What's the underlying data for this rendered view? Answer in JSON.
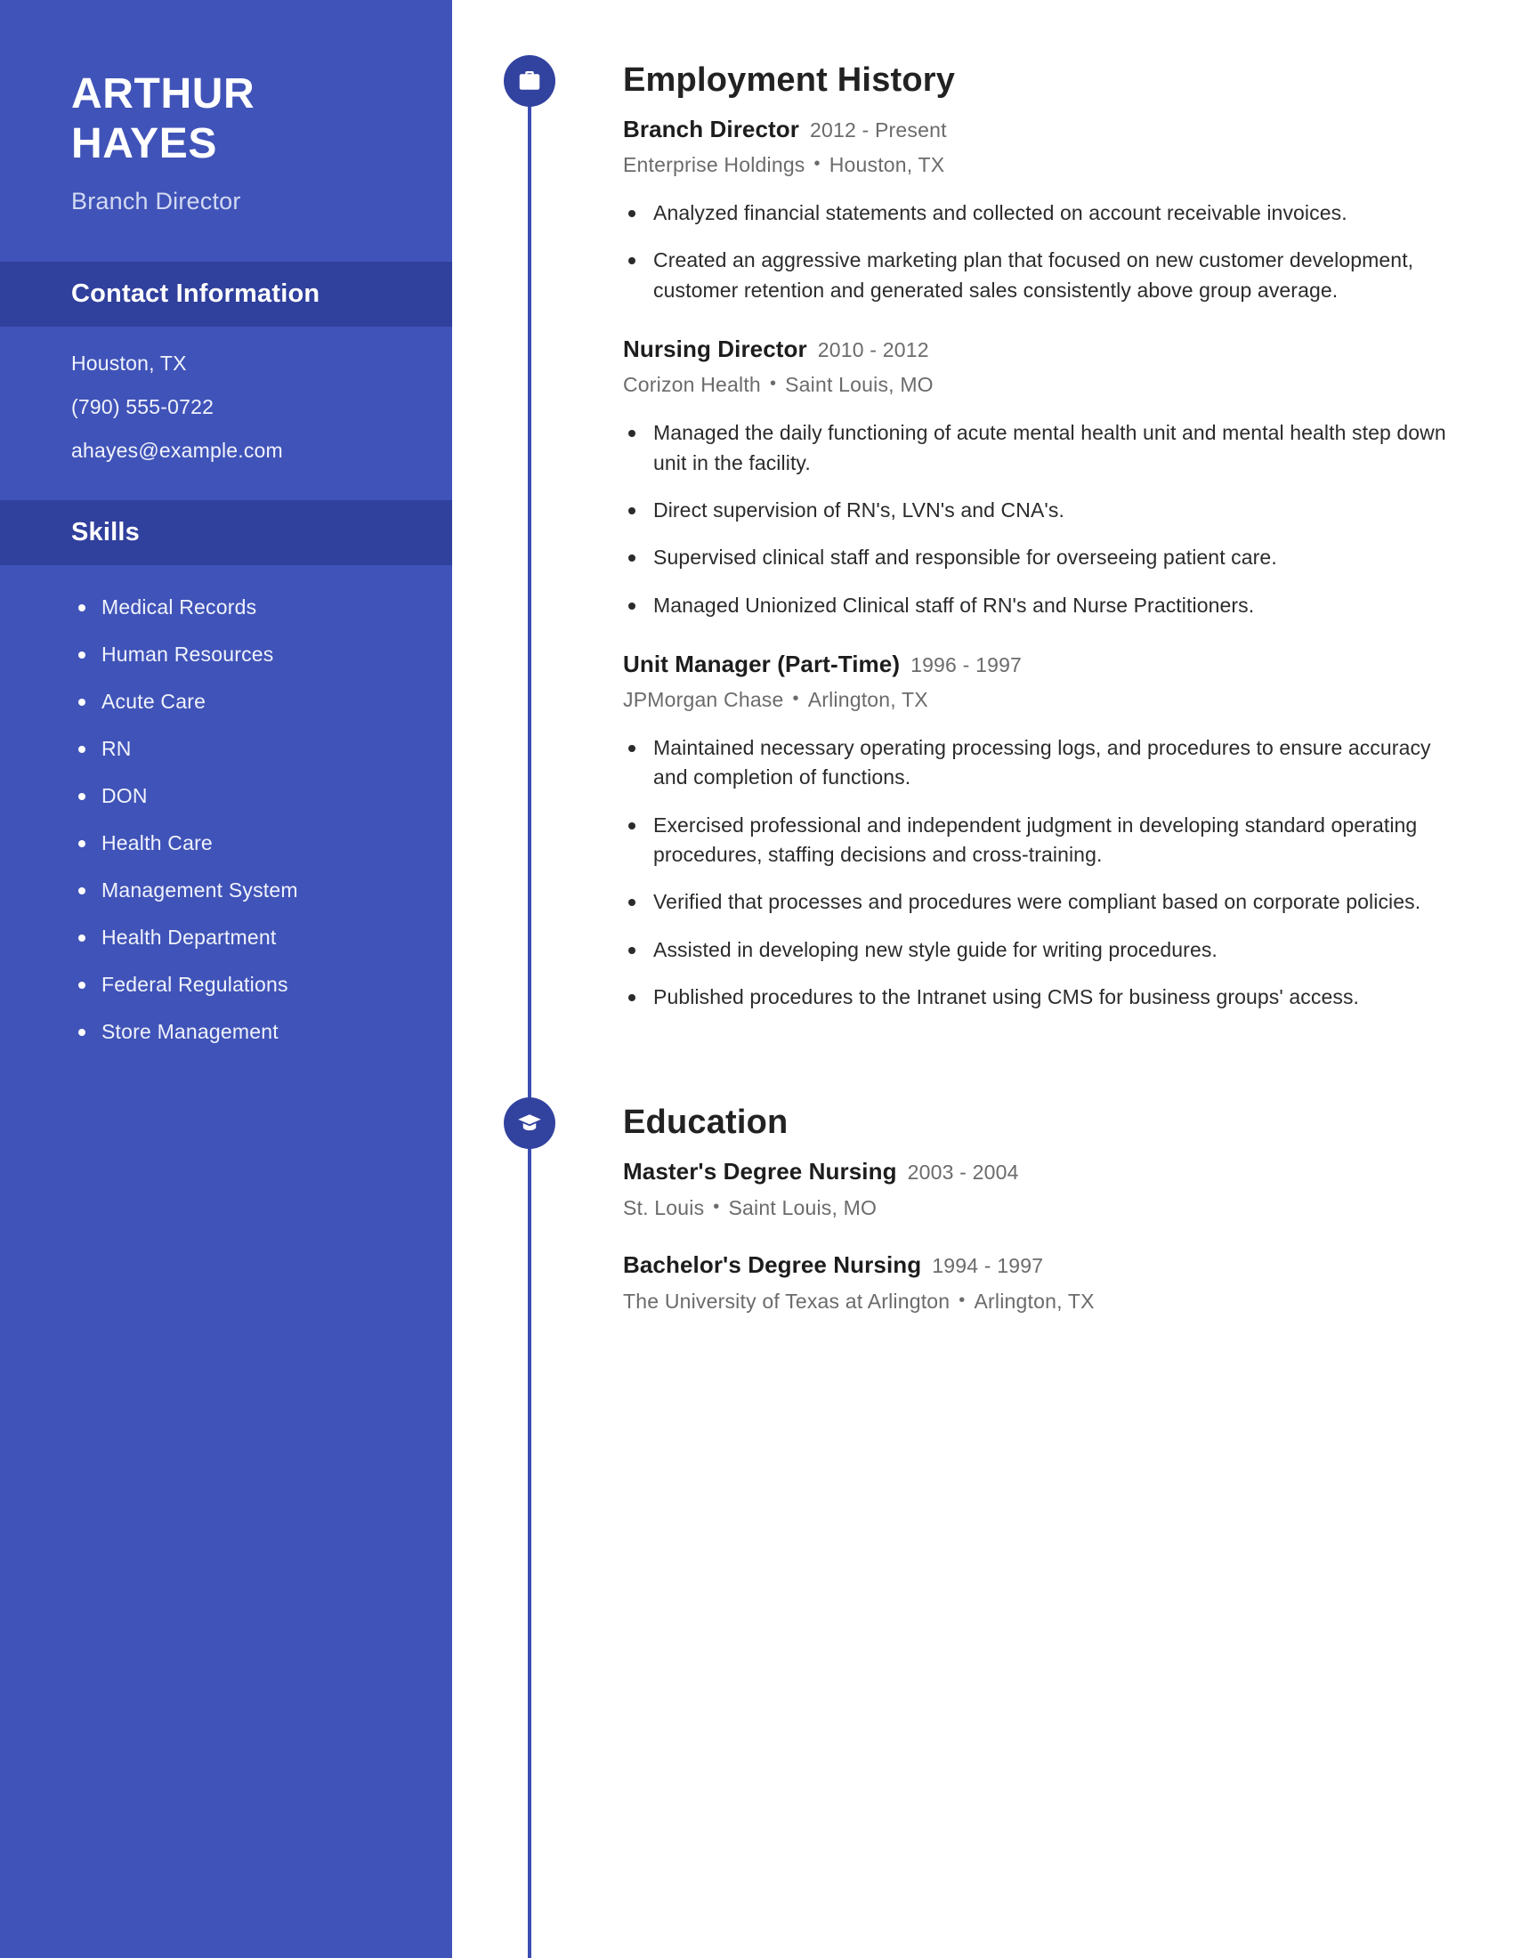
{
  "sidebar": {
    "name": "ARTHUR HAYES",
    "title": "Branch Director",
    "contact": {
      "heading": "Contact Information",
      "location": "Houston, TX",
      "phone": "(790) 555-0722",
      "email": "ahayes@example.com"
    },
    "skills": {
      "heading": "Skills",
      "items": [
        "Medical Records",
        "Human Resources",
        "Acute Care",
        "RN",
        "DON",
        "Health Care",
        "Management System",
        "Health Department",
        "Federal Regulations",
        "Store Management"
      ]
    }
  },
  "main": {
    "employment": {
      "heading": "Employment History",
      "icon": "briefcase-icon",
      "entries": [
        {
          "role": "Branch Director",
          "dates": "2012 - Present",
          "company": "Enterprise Holdings",
          "location": "Houston, TX",
          "duties": [
            "Analyzed financial statements and collected on account receivable invoices.",
            "Created an aggressive marketing plan that focused on new customer development, customer retention and generated sales consistently above group average."
          ]
        },
        {
          "role": "Nursing Director",
          "dates": "2010 - 2012",
          "company": "Corizon Health",
          "location": "Saint Louis, MO",
          "duties": [
            "Managed the daily functioning of acute mental health unit and mental health step down unit in the facility.",
            "Direct supervision of RN's, LVN's and CNA's.",
            "Supervised clinical staff and responsible for overseeing patient care.",
            "Managed Unionized Clinical staff of RN's and Nurse Practitioners."
          ]
        },
        {
          "role": "Unit Manager (Part-Time)",
          "dates": "1996 - 1997",
          "company": "JPMorgan Chase",
          "location": "Arlington, TX",
          "duties": [
            "Maintained necessary operating processing logs, and procedures to ensure accuracy and completion of functions.",
            "Exercised professional and independent judgment in developing standard operating procedures, staffing decisions and cross-training.",
            "Verified that processes and procedures were compliant based on corporate policies.",
            "Assisted in developing new style guide for writing procedures.",
            "Published procedures to the Intranet using CMS for business groups' access."
          ]
        }
      ]
    },
    "education": {
      "heading": "Education",
      "icon": "graduation-cap-icon",
      "entries": [
        {
          "degree": "Master's Degree Nursing",
          "dates": "2003 - 2004",
          "school": "St. Louis",
          "location": "Saint Louis, MO"
        },
        {
          "degree": "Bachelor's Degree Nursing",
          "dates": "1994 - 1997",
          "school": "The University of Texas at Arlington",
          "location": "Arlington, TX"
        }
      ]
    }
  },
  "theme": {
    "sidebar_bg": "#4053b8",
    "band_bg": "#30409d",
    "accent": "#32429f",
    "text_dark": "#1d1d1d",
    "text_muted": "#6b6b6b"
  },
  "separator": "•"
}
